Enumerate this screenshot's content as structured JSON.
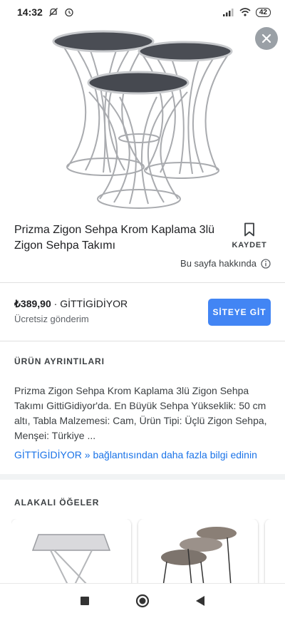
{
  "status_bar": {
    "time": "14:32",
    "battery": "42"
  },
  "product": {
    "title": "Prizma Zigon Sehpa Krom Kaplama 3lü Zigon Sehpa Takımı"
  },
  "actions": {
    "save_label": "KAYDET",
    "about_page": "Bu sayfa hakkında"
  },
  "offer": {
    "price": "₺389,90",
    "separator": "·",
    "store": "GİTTİGİDİYOR",
    "shipping": "Ücretsiz gönderim",
    "visit_button": "SİTEYE GİT"
  },
  "details": {
    "heading": "ÜRÜN AYRINTILARI",
    "description": "Prizma Zigon Sehpa Krom Kaplama 3lü Zigon Sehpa Takımı GittiGidiyor'da. En Büyük Sehpa Yükseklik: 50 cm altı, Tabla Malzemesi: Cam, Ürün Tipi: Üçlü Zigon Sehpa, Menşei: Türkiye ...",
    "more_link": "GİTTİGİDİYOR » bağlantısından daha fazla bilgi edinin"
  },
  "related": {
    "heading": "ALAKALI ÖĞELER"
  },
  "colors": {
    "accent": "#4285f4",
    "link": "#1a73e8"
  }
}
